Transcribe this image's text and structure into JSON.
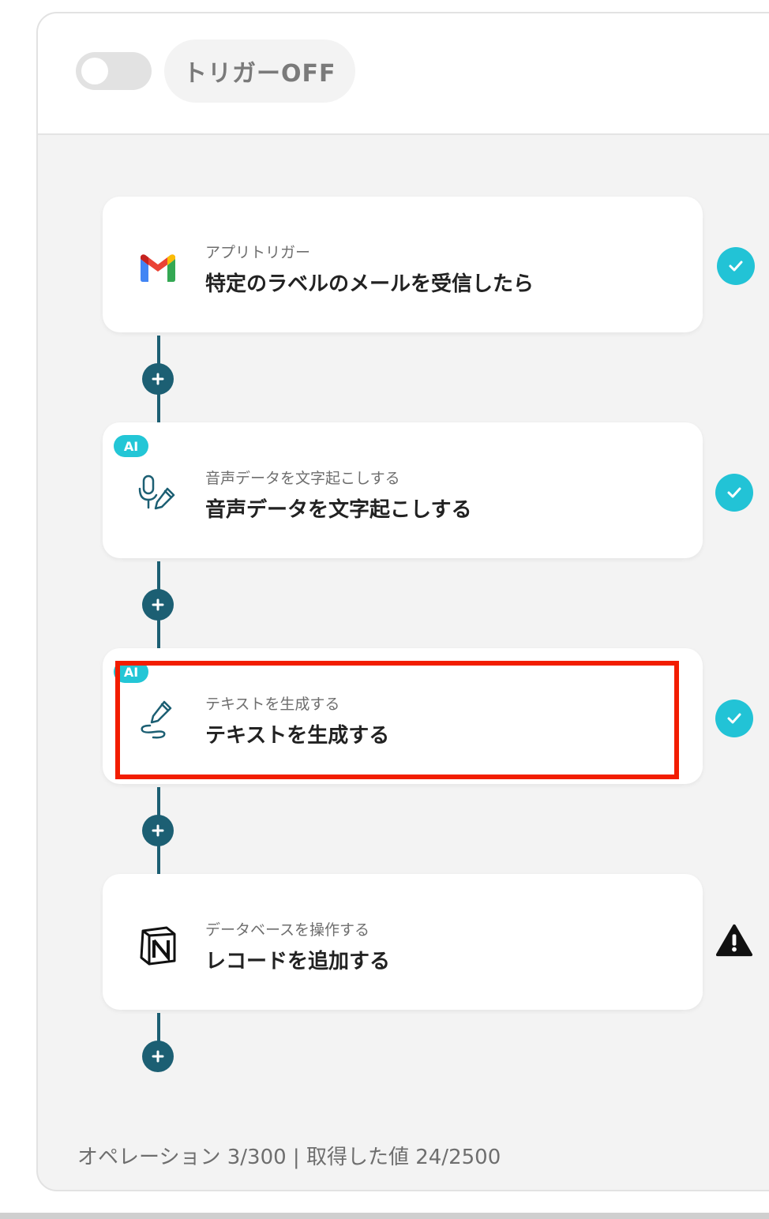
{
  "header": {
    "toggle_state": "off",
    "trigger_status": "トリガーOFF"
  },
  "steps": [
    {
      "subtitle": "アプリトリガー",
      "title": "特定のラベルのメールを受信したら",
      "icon": "gmail-icon",
      "ai": false,
      "status": "complete"
    },
    {
      "subtitle": "音声データを文字起こしする",
      "title": "音声データを文字起こしする",
      "icon": "microphone-pen-icon",
      "ai": true,
      "ai_label": "AI",
      "status": "complete"
    },
    {
      "subtitle": "テキストを生成する",
      "title": "テキストを生成する",
      "icon": "pen-scribble-icon",
      "ai": true,
      "ai_label": "AI",
      "status": "complete",
      "highlighted": true
    },
    {
      "subtitle": "データベースを操作する",
      "title": "レコードを追加する",
      "icon": "notion-icon",
      "ai": false,
      "status": "warning"
    }
  ],
  "footer": {
    "text": "オペレーション 3/300 | 取得した値 24/2500"
  },
  "colors": {
    "accent": "#1c5f73",
    "success": "#22c3d6",
    "ai_badge": "#23c6d6",
    "highlight": "#f21d00"
  }
}
